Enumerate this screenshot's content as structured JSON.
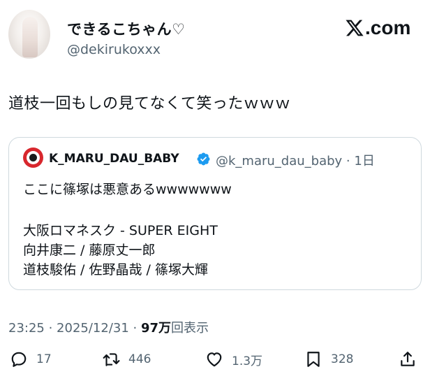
{
  "post": {
    "display_name": "できるこちゃん♡",
    "handle": "@dekirukoxxx",
    "text": "道枝一回もしの見てなくて笑ったｗｗｗ",
    "timestamp": "23:25 · 2025/12/31 · ",
    "views_count": "97万",
    "views_label": "回表示"
  },
  "brand": {
    "logo_text": ".com",
    "logo_name": "X.com"
  },
  "quote": {
    "name": "K_MARU_DAU_BABY",
    "handle_time": "@k_maru_dau_baby · 1日",
    "lines": [
      "ここに篠塚は悪意あるwwwwwww",
      "大阪ロマネスク - SUPER EIGHT",
      "向井康二 / 藤原丈一郎",
      "道枝駿佑 / 佐野晶哉 / 篠塚大輝"
    ]
  },
  "actions": {
    "reply": {
      "icon": "reply-icon",
      "count": "17"
    },
    "retweet": {
      "icon": "retweet-icon",
      "count": "446"
    },
    "like": {
      "icon": "heart-icon",
      "count": "1.3万"
    },
    "bookmark": {
      "icon": "bookmark-icon",
      "count": "328"
    },
    "share": {
      "icon": "share-icon"
    }
  },
  "colors": {
    "text": "#0f1419",
    "secondary": "#536471",
    "border": "#cfd9de",
    "verified": "#1d9bf0"
  }
}
